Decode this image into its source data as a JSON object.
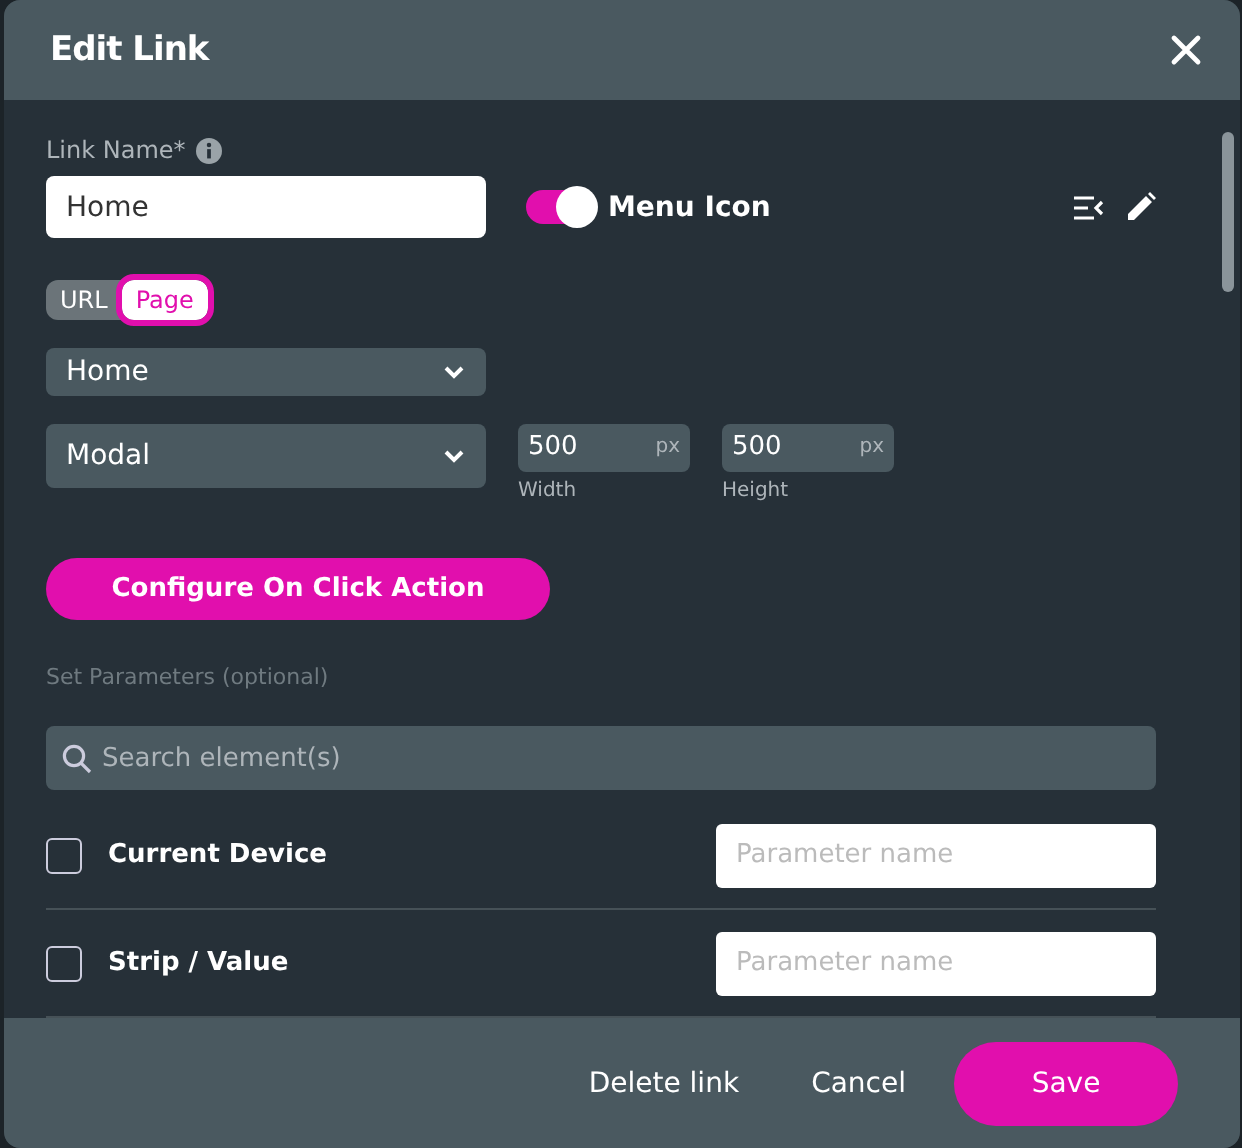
{
  "dialog": {
    "title": "Edit Link"
  },
  "link_name": {
    "label": "Link Name*",
    "value": "Home"
  },
  "menu_icon": {
    "label": "Menu Icon",
    "on": true
  },
  "link_type": [
    {
      "label": "URL",
      "selected": false
    },
    {
      "label": "Page",
      "selected": true
    }
  ],
  "page_select": {
    "value": "Home"
  },
  "open_as_select": {
    "value": "Modal"
  },
  "size": [
    {
      "value": "500",
      "unit": "px",
      "label": "Width"
    },
    {
      "value": "500",
      "unit": "px",
      "label": "Height"
    }
  ],
  "configure_button": "Configure On Click Action",
  "parameters": {
    "heading": "Set Parameters (optional)",
    "search_placeholder": "Search element(s)",
    "rows": [
      {
        "label": "Current Device",
        "checked": false,
        "placeholder": "Parameter name"
      },
      {
        "label": "Strip / Value",
        "checked": false,
        "placeholder": "Parameter name"
      }
    ]
  },
  "buttons": [
    {
      "label": "Delete link",
      "kind": "text"
    },
    {
      "label": "Cancel",
      "kind": "text"
    },
    {
      "label": "Save",
      "kind": "primary"
    }
  ]
}
